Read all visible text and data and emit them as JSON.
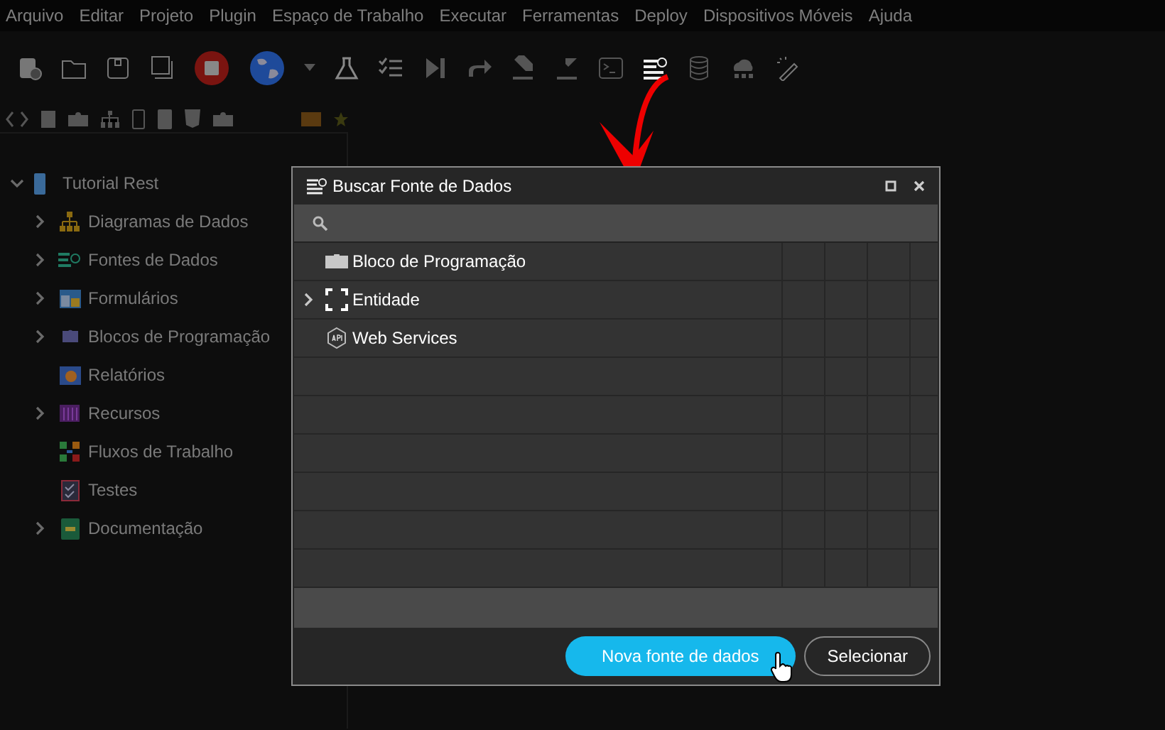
{
  "menu": [
    "Arquivo",
    "Editar",
    "Projeto",
    "Plugin",
    "Espaço de Trabalho",
    "Executar",
    "Ferramentas",
    "Deploy",
    "Dispositivos Móveis",
    "Ajuda"
  ],
  "tree": {
    "label": "Tutorial Rest",
    "expanded": true,
    "children": [
      {
        "label": "Diagramas de Dados",
        "expandable": true
      },
      {
        "label": "Fontes de Dados",
        "expandable": true
      },
      {
        "label": "Formulários",
        "expandable": true
      },
      {
        "label": "Blocos de Programação",
        "expandable": true
      },
      {
        "label": "Relatórios",
        "expandable": false
      },
      {
        "label": "Recursos",
        "expandable": true
      },
      {
        "label": "Fluxos de Trabalho",
        "expandable": false
      },
      {
        "label": "Testes",
        "expandable": false
      },
      {
        "label": "Documentação",
        "expandable": true
      }
    ]
  },
  "dialog": {
    "title": "Buscar Fonte de Dados",
    "rows": [
      {
        "label": "Bloco de Programação",
        "expandable": false
      },
      {
        "label": "Entidade",
        "expandable": true
      },
      {
        "label": "Web Services",
        "expandable": false
      }
    ],
    "buttons": [
      {
        "label": "Nova fonte de dados",
        "primary": true
      },
      {
        "label": "Selecionar",
        "primary": false
      }
    ]
  }
}
